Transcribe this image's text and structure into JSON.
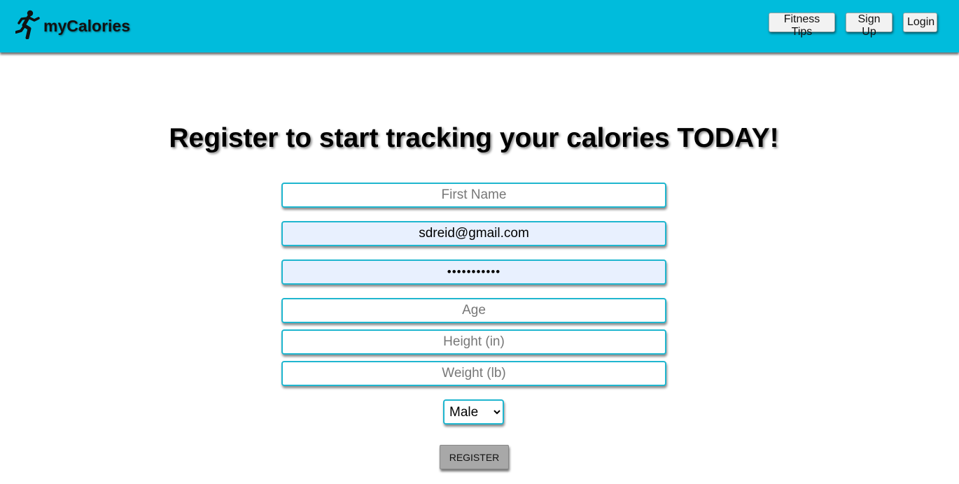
{
  "brand": {
    "name": "myCalories",
    "icon": "running-person-icon"
  },
  "nav": {
    "fitness_tips": "Fitness Tips",
    "sign_up": "Sign Up",
    "login": "Login"
  },
  "headline": "Register to start tracking your calories TODAY!",
  "form": {
    "first_name": {
      "placeholder": "First Name",
      "value": ""
    },
    "email": {
      "placeholder": "",
      "value": "sdreid@gmail.com"
    },
    "password": {
      "placeholder": "",
      "value": "sdreid12345"
    },
    "age": {
      "placeholder": "Age",
      "value": ""
    },
    "height": {
      "placeholder": "Height (in)",
      "value": ""
    },
    "weight": {
      "placeholder": "Weight (lb)",
      "value": ""
    },
    "sex": {
      "selected": "Male"
    },
    "register_label": "REGISTER"
  },
  "colors": {
    "navbar_bg": "#00bcdc",
    "field_border": "#1fb6cf",
    "autofill_bg": "#e8f0fe",
    "button_bg": "#a8a8a8"
  }
}
